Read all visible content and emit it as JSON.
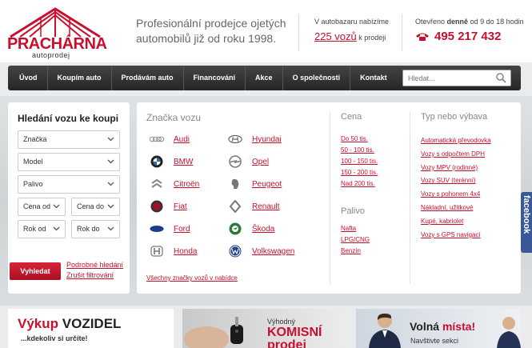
{
  "header": {
    "logo_text": "PRACHÁRNA",
    "logo_sub": "autoprodej",
    "tagline": "Profesionální prodejce ojetých automobilů již od roku 1998.",
    "offer_line1": "V autobazaru nabízíme",
    "offer_count": "225 vozů",
    "offer_suffix": "k prodeji",
    "hours_prefix": "Otevřeno",
    "hours_bold": "denně",
    "hours_suffix": "od 9 do 18 hodin",
    "phone": "495 217 432"
  },
  "nav": {
    "items": [
      "Úvod",
      "Koupím auto",
      "Prodávám auto",
      "Financování",
      "Akce",
      "O společnosti",
      "Kontakt"
    ],
    "search_placeholder": "Hledat..."
  },
  "search": {
    "title": "Hledání vozu ke koupi",
    "make": "Značka",
    "model": "Model",
    "fuel": "Palivo",
    "price_from": "Cena od",
    "price_to": "Cena do",
    "year_from": "Rok od",
    "year_to": "Rok do",
    "submit": "Vyhledat",
    "advanced": "Podrobné hledání",
    "reset": "Zrušit filtrování"
  },
  "brands": {
    "title": "Značka vozu",
    "left": [
      "Audi",
      "BMW",
      "Citroën",
      "Fiat",
      "Ford",
      "Honda"
    ],
    "right": [
      "Hyundai",
      "Opel",
      "Peugeot",
      "Renault",
      "Škoda",
      "Volkswagen"
    ],
    "all_link": "Všechny značky vozů v nabídce"
  },
  "price": {
    "title": "Cena",
    "links": [
      "Do 50 tis.",
      "50 - 100 tis.",
      "100 - 150 tis.",
      "150 - 200 tis.",
      "Nad 200 tis."
    ]
  },
  "fuel": {
    "title": "Palivo",
    "links": [
      "Nafta",
      "LPG/CNG",
      "Benzín"
    ]
  },
  "type": {
    "title": "Typ nebo výbava",
    "links": [
      "Automatická převodovka",
      "Vozy s odpočtem DPH",
      "Vozy MPV (rodinné)",
      "Vozy SUV (terénní)",
      "Vozy s pohonem 4x4",
      "Nákladní, užitkové",
      "Kupé, kabriolet",
      "Vozy s GPS navigací"
    ]
  },
  "facebook": "facebook",
  "banners": {
    "b1_red": "Výkup",
    "b1_black": "VOZIDEL",
    "b1_sub": "...kdekoliv si určíte!",
    "b2_small": "Výhodný",
    "b2_big1": "KOMISNÍ",
    "b2_big2": "prodej",
    "b3_black": "Volná",
    "b3_red": "místa!",
    "b3_sub": "Navštivte sekci"
  },
  "colors": {
    "brand_red": "#c8102e",
    "nav_dark": "#2e2e2e",
    "facebook": "#3b5998"
  }
}
